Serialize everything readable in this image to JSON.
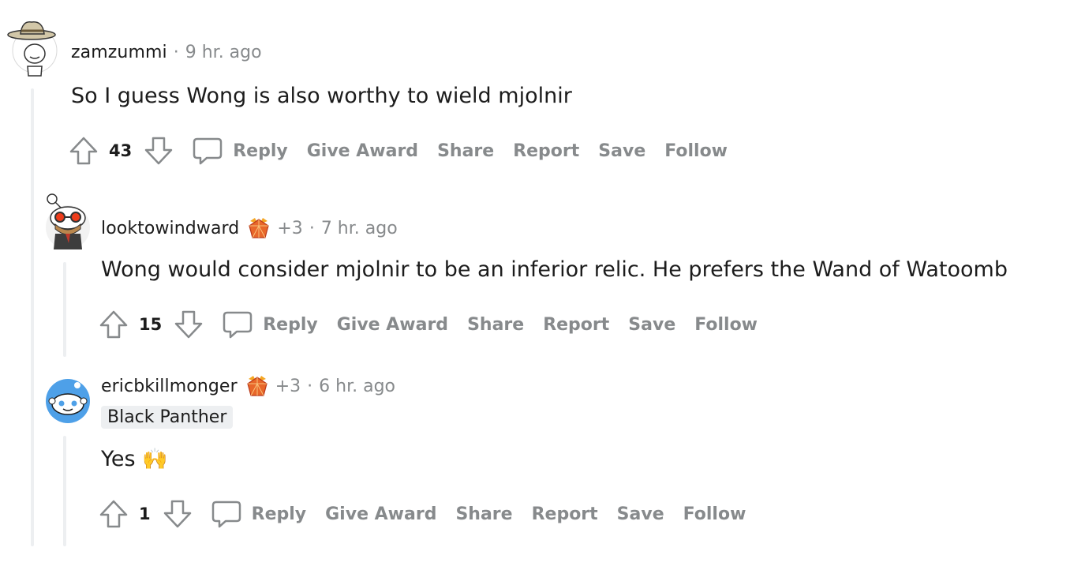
{
  "comments": [
    {
      "username": "zamzummi",
      "separator": "·",
      "time": "9 hr. ago",
      "body": "So I guess Wong is also worthy to wield mjolnir",
      "score": "43",
      "actions": {
        "reply": "Reply",
        "give_award": "Give Award",
        "share": "Share",
        "report": "Report",
        "save": "Save",
        "follow": "Follow"
      },
      "avatar_icon": "snoo-avatar-cowboy-hat"
    },
    {
      "username": "looktowindward",
      "awards_count": "+3",
      "award_icon": "award-icon",
      "separator": "·",
      "time": "7 hr. ago",
      "body": "Wong would consider mjolnir to be an inferior relic. He prefers the Wand of Watoomb",
      "score": "15",
      "actions": {
        "reply": "Reply",
        "give_award": "Give Award",
        "share": "Share",
        "report": "Report",
        "save": "Save",
        "follow": "Follow"
      },
      "avatar_icon": "snoo-avatar-glasses-suit"
    },
    {
      "username": "ericbkillmonger",
      "awards_count": "+3",
      "award_icon": "award-icon",
      "separator": "·",
      "time": "6 hr. ago",
      "flair": "Black Panther",
      "body": "Yes",
      "body_emoji": "🙌",
      "score": "1",
      "actions": {
        "reply": "Reply",
        "give_award": "Give Award",
        "share": "Share",
        "report": "Report",
        "save": "Save",
        "follow": "Follow"
      },
      "avatar_icon": "snoo-avatar-blue"
    }
  ],
  "colors": {
    "text": "#1c1c1c",
    "meta": "#878a8c",
    "thread_line": "#edeff1",
    "flair_bg": "#edeff1",
    "avatar_blue": "#4ea0e8"
  }
}
